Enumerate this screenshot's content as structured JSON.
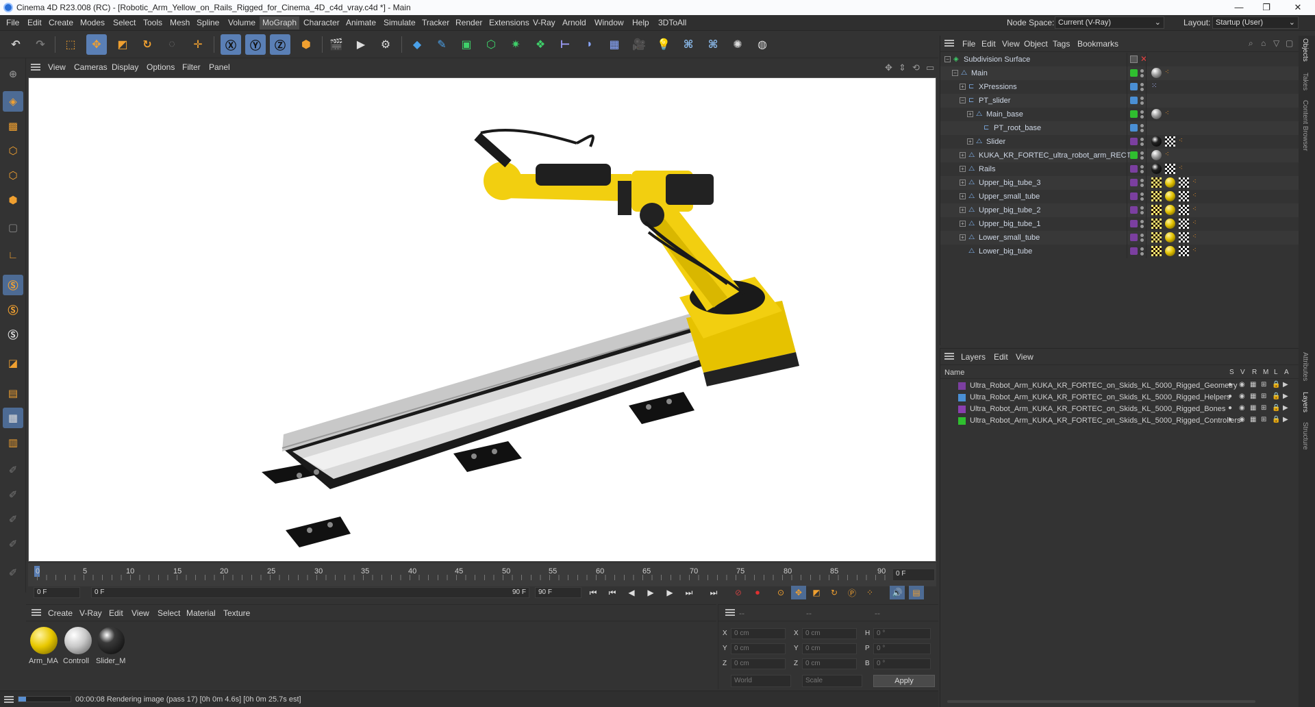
{
  "window": {
    "title": "Cinema 4D R23.008 (RC) - [Robotic_Arm_Yellow_on_Rails_Rigged_for_Cinema_4D_c4d_vray.c4d *] - Main",
    "min": "—",
    "max": "❐",
    "close": "✕"
  },
  "menu": [
    "File",
    "Edit",
    "Create",
    "Modes",
    "Select",
    "Tools",
    "Mesh",
    "Spline",
    "Volume",
    "MoGraph",
    "Character",
    "Animate",
    "Simulate",
    "Tracker",
    "Render",
    "Extensions",
    "V-Ray",
    "Arnold",
    "Window",
    "Help",
    "3DToAll"
  ],
  "menu_active": "MoGraph",
  "node_space": {
    "label": "Node Space:",
    "value": "Current (V-Ray)"
  },
  "layout": {
    "label": "Layout:",
    "value": "Startup (User)"
  },
  "viewport_menu": [
    "View",
    "Cameras",
    "Display",
    "Options",
    "Filter",
    "Panel"
  ],
  "objects_menu": [
    "File",
    "Edit",
    "View",
    "Object",
    "Tags",
    "Bookmarks"
  ],
  "objects": [
    {
      "name": "Subdivision Surface",
      "depth": 0,
      "layer": "",
      "tags": []
    },
    {
      "name": "Main",
      "depth": 1,
      "layer": "#2fbf2f",
      "tags": [
        "ball-grey",
        "orange"
      ]
    },
    {
      "name": "XPressions",
      "depth": 2,
      "layer": "#4a8fd4",
      "tags": [
        "xpresso"
      ]
    },
    {
      "name": "PT_slider",
      "depth": 2,
      "layer": "#4a8fd4",
      "tags": []
    },
    {
      "name": "Main_base",
      "depth": 3,
      "layer": "#2fbf2f",
      "tags": [
        "ball-grey",
        "orange"
      ]
    },
    {
      "name": "PT_root_base",
      "depth": 4,
      "layer": "#4a8fd4",
      "tags": []
    },
    {
      "name": "Slider",
      "depth": 3,
      "layer": "#7b3fa0",
      "tags": [
        "ball-black",
        "check",
        "orange"
      ]
    },
    {
      "name": "KUKA_KR_FORTEC_ultra_robot_arm_RECT",
      "depth": 2,
      "layer": "#2fbf2f",
      "tags": [
        "ball-grey",
        "orange"
      ]
    },
    {
      "name": "Rails",
      "depth": 2,
      "layer": "#7b3fa0",
      "tags": [
        "ball-black",
        "check",
        "orange"
      ]
    },
    {
      "name": "Upper_big_tube_3",
      "depth": 2,
      "layer": "#7b3fa0",
      "tags": [
        "check-orange",
        "ball-yellow",
        "check",
        "orange"
      ]
    },
    {
      "name": "Upper_small_tube",
      "depth": 2,
      "layer": "#7b3fa0",
      "tags": [
        "check-orange",
        "ball-yellow",
        "check",
        "orange"
      ]
    },
    {
      "name": "Upper_big_tube_2",
      "depth": 2,
      "layer": "#7b3fa0",
      "tags": [
        "check-orange",
        "ball-yellow",
        "check",
        "orange"
      ]
    },
    {
      "name": "Upper_big_tube_1",
      "depth": 2,
      "layer": "#7b3fa0",
      "tags": [
        "check-orange",
        "ball-yellow",
        "check",
        "orange"
      ]
    },
    {
      "name": "Lower_small_tube",
      "depth": 2,
      "layer": "#7b3fa0",
      "tags": [
        "check-orange",
        "ball-yellow",
        "check",
        "orange"
      ]
    },
    {
      "name": "Lower_big_tube",
      "depth": 2,
      "layer": "#7b3fa0",
      "tags": [
        "check-orange",
        "ball-yellow",
        "check",
        "orange"
      ]
    }
  ],
  "layers_menu": [
    "Layers",
    "Edit",
    "View"
  ],
  "layers_header": {
    "name": "Name",
    "cols": [
      "S",
      "V",
      "R",
      "M",
      "L",
      "A"
    ]
  },
  "layers": [
    {
      "name": "Ultra_Robot_Arm_KUKA_KR_FORTEC_on_Skids_KL_5000_Rigged_Geometry",
      "color": "#7b3fa0"
    },
    {
      "name": "Ultra_Robot_Arm_KUKA_KR_FORTEC_on_Skids_KL_5000_Rigged_Helpers",
      "color": "#4a8fd4"
    },
    {
      "name": "Ultra_Robot_Arm_KUKA_KR_FORTEC_on_Skids_KL_5000_Rigged_Bones",
      "color": "#8a3fb0"
    },
    {
      "name": "Ultra_Robot_Arm_KUKA_KR_FORTEC_on_Skids_KL_5000_Rigged_Controllers",
      "color": "#2fbf2f"
    }
  ],
  "right_tabs": [
    "Objects",
    "Takes",
    "Content Browser",
    "Attributes",
    "Layers",
    "Structure"
  ],
  "timeline": {
    "ticks": [
      "0",
      "5",
      "10",
      "15",
      "20",
      "25",
      "30",
      "35",
      "40",
      "45",
      "50",
      "55",
      "60",
      "65",
      "70",
      "75",
      "80",
      "85",
      "90"
    ],
    "current_field": "0 F",
    "start": "0 F",
    "start2": "0 F",
    "end": "90 F",
    "end2": "90 F"
  },
  "materials_menu": [
    "Create",
    "V-Ray",
    "Edit",
    "View",
    "Select",
    "Material",
    "Texture"
  ],
  "materials": [
    {
      "name": "Arm_MA",
      "kind": "yellow"
    },
    {
      "name": "Controll",
      "kind": "white"
    },
    {
      "name": "Slider_M",
      "kind": "black"
    }
  ],
  "coords": {
    "header": [
      "--",
      "--",
      "--"
    ],
    "rows": [
      {
        "a": "X",
        "av": "0 cm",
        "b": "X",
        "bv": "0 cm",
        "c": "H",
        "cv": "0 °"
      },
      {
        "a": "Y",
        "av": "0 cm",
        "b": "Y",
        "bv": "0 cm",
        "c": "P",
        "cv": "0 °"
      },
      {
        "a": "Z",
        "av": "0 cm",
        "b": "Z",
        "bv": "0 cm",
        "c": "B",
        "cv": "0 °"
      }
    ],
    "mode1": "World",
    "mode2": "Scale",
    "apply": "Apply"
  },
  "status": {
    "text": "00:00:08 Rendering image (pass 17) [0h  0m  4.6s] [0h  0m 25.7s est]",
    "progress": 0.15
  },
  "accent": "#5a7fb5"
}
